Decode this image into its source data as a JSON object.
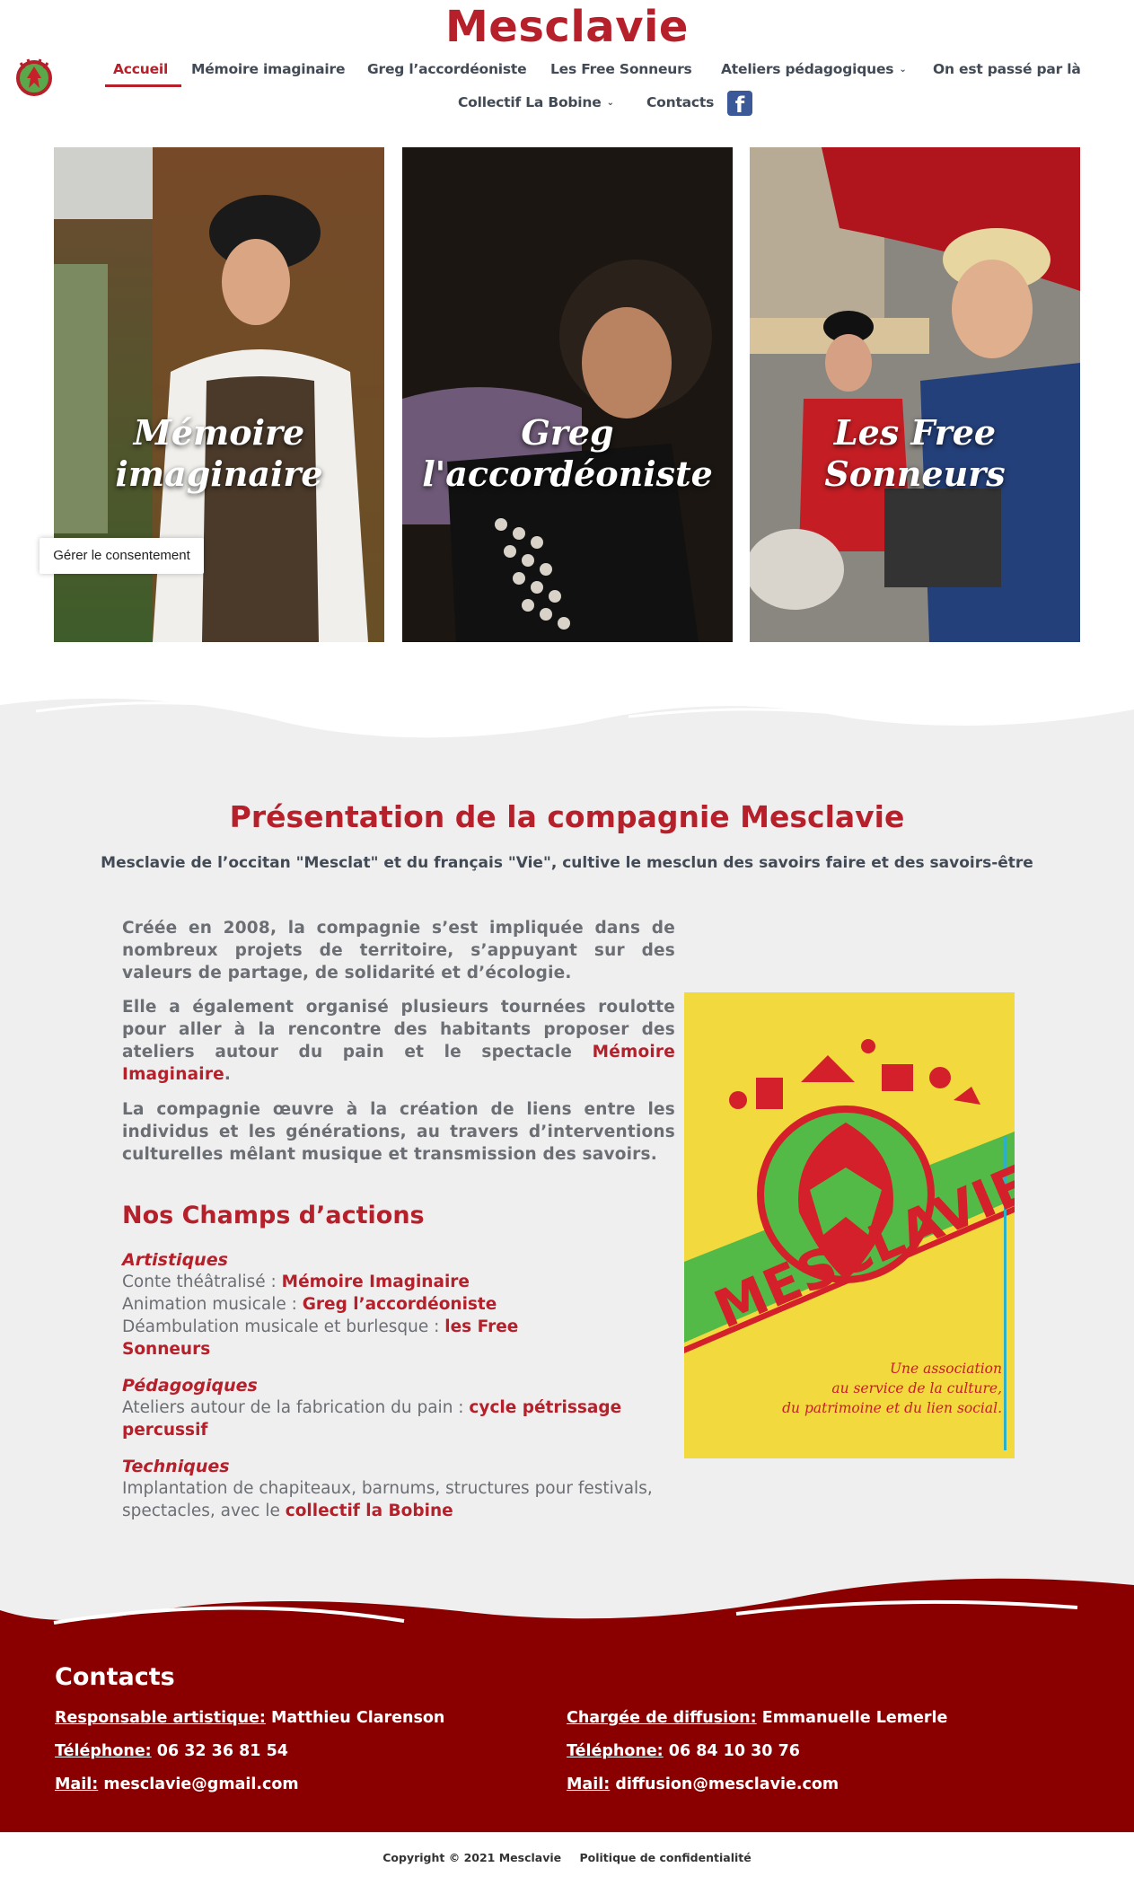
{
  "site": {
    "title": "Mesclavie"
  },
  "nav": {
    "items": [
      {
        "label": "Accueil"
      },
      {
        "label": "Mémoire imaginaire"
      },
      {
        "label": "Greg l’accordéoniste"
      },
      {
        "label": "Les Free Sonneurs"
      },
      {
        "label": "Ateliers pédagogiques"
      },
      {
        "label": "On est passé par là"
      },
      {
        "label": "Collectif La Bobine"
      },
      {
        "label": "Contacts"
      }
    ],
    "facebook": "f"
  },
  "cards": [
    {
      "caption_line1": "Mémoire",
      "caption_line2": "imaginaire"
    },
    {
      "caption_line1": "Greg",
      "caption_line2": "l'accordéoniste"
    },
    {
      "caption_line1": "Les Free Sonneurs",
      "caption_line2": ""
    }
  ],
  "consent": {
    "label": "Gérer le consentement"
  },
  "presentation": {
    "title": "Présentation de la compagnie Mesclavie",
    "subtitle": "Mesclavie de l’occitan \"Mesclat\" et du français \"Vie\", cultive le mesclun des savoirs faire et des savoirs-être",
    "p1": "Créée en 2008, la compagnie s’est impliquée dans de nombreux projets de territoire, s’appuyant sur des valeurs de partage, de solidarité et d’écologie.",
    "p2_text": "Elle a également organisé plusieurs tournées roulotte pour aller à la rencontre des habitants proposer des ateliers autour du pain et le spectacle",
    "p2_link": "Mémoire Imaginaire",
    "p2_end": ".",
    "p3": "La compagnie œuvre à la création de liens entre les individus et les générations, au travers d’interventions culturelles mêlant musique et transmission des savoirs."
  },
  "champs": {
    "title": "Nos Champs d’actions",
    "artistiques": {
      "label": "Artistiques",
      "l1_text": "Conte théâtralisé : ",
      "l1_link": "Mémoire Imaginaire",
      "l2_text": "Animation musicale : ",
      "l2_link": "Greg l’accordéoniste",
      "l3_text": "Déambulation musicale et burlesque : ",
      "l3_link": "les Free Sonneurs"
    },
    "pedagogiques": {
      "label": "Pédagogiques",
      "l1_text": "Ateliers autour de la fabrication du pain : ",
      "l1_link": "cycle pétrissage percussif"
    },
    "techniques": {
      "label": "Techniques",
      "l1_text": "Implantation de chapiteaux, barnums, structures pour festivals, spectacles, avec le ",
      "l1_link": "collectif la Bobine"
    }
  },
  "poster": {
    "brand": "MESCLAVIE",
    "tagline1": "Une association",
    "tagline2": "au service de la culture,",
    "tagline3": "du patrimoine et du lien social."
  },
  "footer": {
    "title": "Contacts",
    "left": {
      "resp_label": "Responsable artistique:",
      "resp_value": "Matthieu Clarenson",
      "tel_label": "Téléphone:",
      "tel_value": "06 32 36 81 54",
      "mail_label": "Mail:",
      "mail_value": "mesclavie@gmail.com"
    },
    "right": {
      "resp_label": "Chargée de diffusion:",
      "resp_value": "Emmanuelle Lemerle",
      "tel_label": "Téléphone:",
      "tel_value": "06 84 10 30 76",
      "mail_label": "Mail:",
      "mail_value": "diffusion@mesclavie.com"
    },
    "copyright": "Copyright © 2021 Mesclavie",
    "privacy": "Politique de confidentialité"
  },
  "colors": {
    "brand_red": "#b5202a",
    "footer_red": "#8a0000",
    "grey_bg": "#efeff0"
  }
}
